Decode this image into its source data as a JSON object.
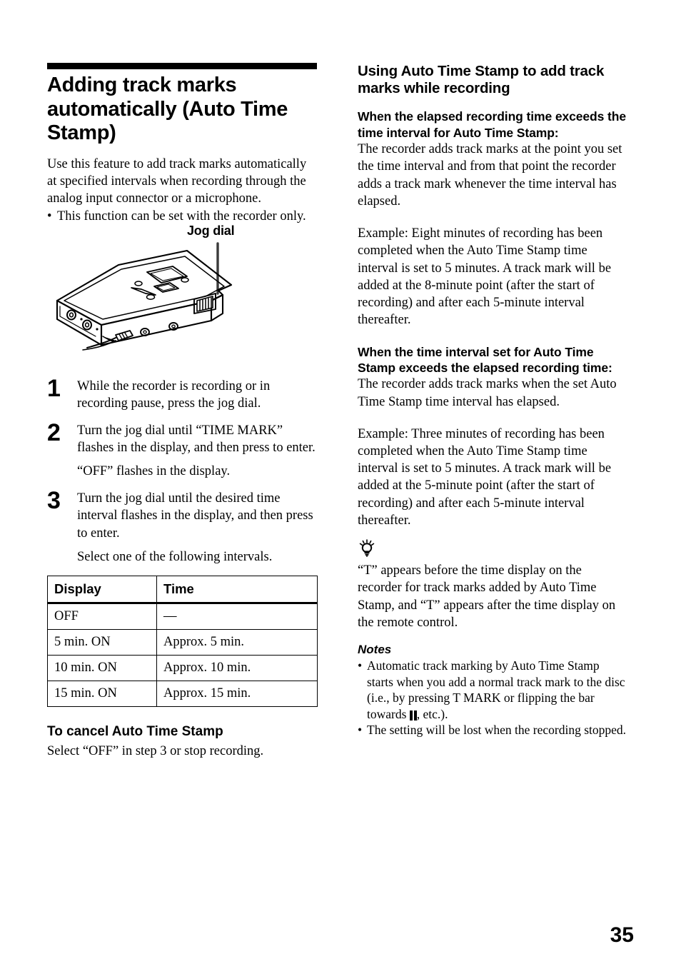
{
  "page": {
    "number": "35"
  },
  "left_column": {
    "chapter_title": "Adding track marks automatically (Auto Time Stamp)",
    "intro": "Use this feature to add track marks automatically at specified intervals when recording through the analog input connector or a microphone.",
    "intro_bullets": [
      "This function can be set with the recorder only."
    ],
    "figure": {
      "callout_label": "Jog dial",
      "device_name": "md-recorder-illustration"
    },
    "steps": [
      {
        "number": "1",
        "text": "While the recorder is recording or in recording pause, press the jog dial.",
        "sub": ""
      },
      {
        "number": "2",
        "text": "Turn the jog dial until “TIME MARK” flashes in the display, and then press to enter.",
        "sub": "“OFF” flashes in the display."
      },
      {
        "number": "3",
        "text": "Turn the jog dial until the desired time interval flashes in the display, and then press to enter.",
        "sub": "Select one of the following intervals."
      }
    ],
    "table": {
      "headers": [
        "Display",
        "Time"
      ],
      "rows": [
        [
          "OFF",
          "—"
        ],
        [
          "5 min.  ON",
          "Approx. 5 min."
        ],
        [
          "10 min.  ON",
          "Approx. 10 min."
        ],
        [
          "15 min.  ON",
          "Approx. 15 min."
        ]
      ]
    },
    "cancel": {
      "heading": "To cancel Auto Time Stamp",
      "text": "Select “OFF” in step 3 or stop recording."
    }
  },
  "right_column": {
    "section_title": "Using Auto Time Stamp to add track marks while recording",
    "case_1": {
      "heading": "When the elapsed recording time exceeds the time interval for Auto Time Stamp:",
      "body": "The recorder adds track marks at the point you set the time interval and from that point the recorder adds a track mark whenever the time interval has elapsed.",
      "example": "Example: Eight minutes of recording has been completed when the Auto Time Stamp time interval is set to 5 minutes. A track mark will be added at the 8-minute point (after the start of recording) and after each 5-minute interval thereafter."
    },
    "case_2": {
      "heading": "When the time interval set for Auto Time Stamp exceeds the elapsed recording time:",
      "body": "The recorder adds track marks when the set Auto Time Stamp time interval has elapsed.",
      "example": "Example: Three minutes of recording has been completed when the Auto Time Stamp time interval is set to 5 minutes. A track mark will be added at the 5-minute point (after the start of recording) and after each 5-minute interval thereafter."
    },
    "tip": {
      "icon": "light-bulb-icon",
      "text": "“T” appears before the time display on the recorder for track marks added by Auto Time Stamp, and “T” appears after the time display on the remote control."
    },
    "notes": {
      "heading": "Notes",
      "items_before_glyph": [
        "Automatic track marking by Auto Time Stamp starts when you add a normal track mark to the disc (i.e., by pressing T MARK or flipping the bar towards ",
        "The setting will be lost when the recording stopped."
      ],
      "item_1_after_glyph": ", etc.).",
      "glyph": "pause-symbol"
    }
  }
}
